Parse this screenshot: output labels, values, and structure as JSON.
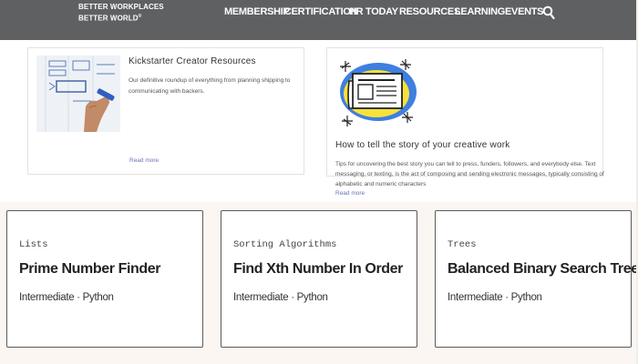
{
  "header": {
    "logo_line1": "BETTER WORKPLACES",
    "logo_line2": "BETTER WORLD",
    "logo_tm": "®",
    "nav": [
      "MEMBERSHIP",
      "CERTIFICATION",
      "HR TODAY",
      "RESOURCES",
      "LEARNING",
      "EVENTS"
    ],
    "search_icon": "search-icon",
    "bg_color": "#5f6062"
  },
  "resources": [
    {
      "title": "Kickstarter Creator Resources",
      "description": "Our definitive roundup of everything from planning shipping to communicating with backers.",
      "read_more": "Read more",
      "image": "whiteboard-hand-illustration"
    },
    {
      "title": "How to tell the story of your creative work",
      "description": "Tips for uncovering the best story you can tell to press, funders, followers, and everybody else. Text messaging, or texting, is the act of composing and sending electronic messages, typically consisting of alphabetic and numeric characters",
      "read_more": "Read more",
      "image": "newspaper-illustration"
    }
  ],
  "courses": [
    {
      "category": "Lists",
      "title": "Prime Number Finder",
      "meta": "Intermediate · Python"
    },
    {
      "category": "Sorting Algorithms",
      "title": "Find Xth Number In Order",
      "meta": "Intermediate · Python"
    },
    {
      "category": "Trees",
      "title": "Balanced Binary Search Tree",
      "meta": "Intermediate · Python"
    }
  ],
  "colors": {
    "link": "#6b73b8",
    "course_section_bg": "#fbf6f1"
  }
}
